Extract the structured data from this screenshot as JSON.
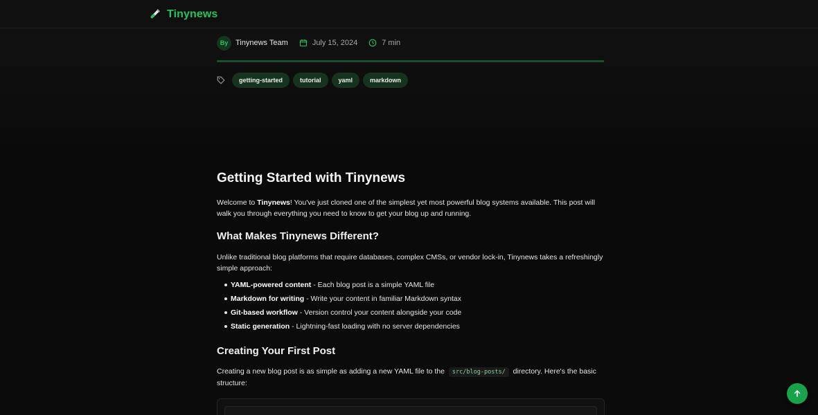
{
  "brand": {
    "name": "Tinynews",
    "icon": "test-tube-icon"
  },
  "meta": {
    "avatar_text": "By",
    "author": "Tinynews Team",
    "date": "July 15, 2024",
    "read_time": "7 min"
  },
  "tags": [
    "getting-started",
    "tutorial",
    "yaml",
    "markdown"
  ],
  "article": {
    "title": "Getting Started with Tinynews",
    "intro": {
      "before": "Welcome to ",
      "bold": "Tinynews",
      "after": "! You've just cloned one of the simplest yet most powerful blog systems available. This post will walk you through everything you need to know to get your blog up and running."
    },
    "section1": {
      "heading": "What Makes Tinynews Different?",
      "text": "Unlike traditional blog platforms that require databases, complex CMSs, or vendor lock-in, Tinynews takes a refreshingly simple approach:",
      "items": [
        {
          "bold": "YAML-powered content",
          "text": " - Each blog post is a simple YAML file"
        },
        {
          "bold": "Markdown for writing",
          "text": " - Write your content in familiar Markdown syntax"
        },
        {
          "bold": "Git-based workflow",
          "text": " - Version control your content alongside your code"
        },
        {
          "bold": "Static generation",
          "text": " - Lightning-fast loading with no server dependencies"
        }
      ]
    },
    "section2": {
      "heading": "Creating Your First Post",
      "text_before": "Creating a new blog post is as simple as adding a new YAML file to the",
      "code": "src/blog-posts/",
      "text_after": "directory. Here's the basic structure:"
    }
  },
  "colors": {
    "accent": "#22c55e",
    "tag_bg": "#15331f",
    "back_to_top": "#16a34a"
  }
}
